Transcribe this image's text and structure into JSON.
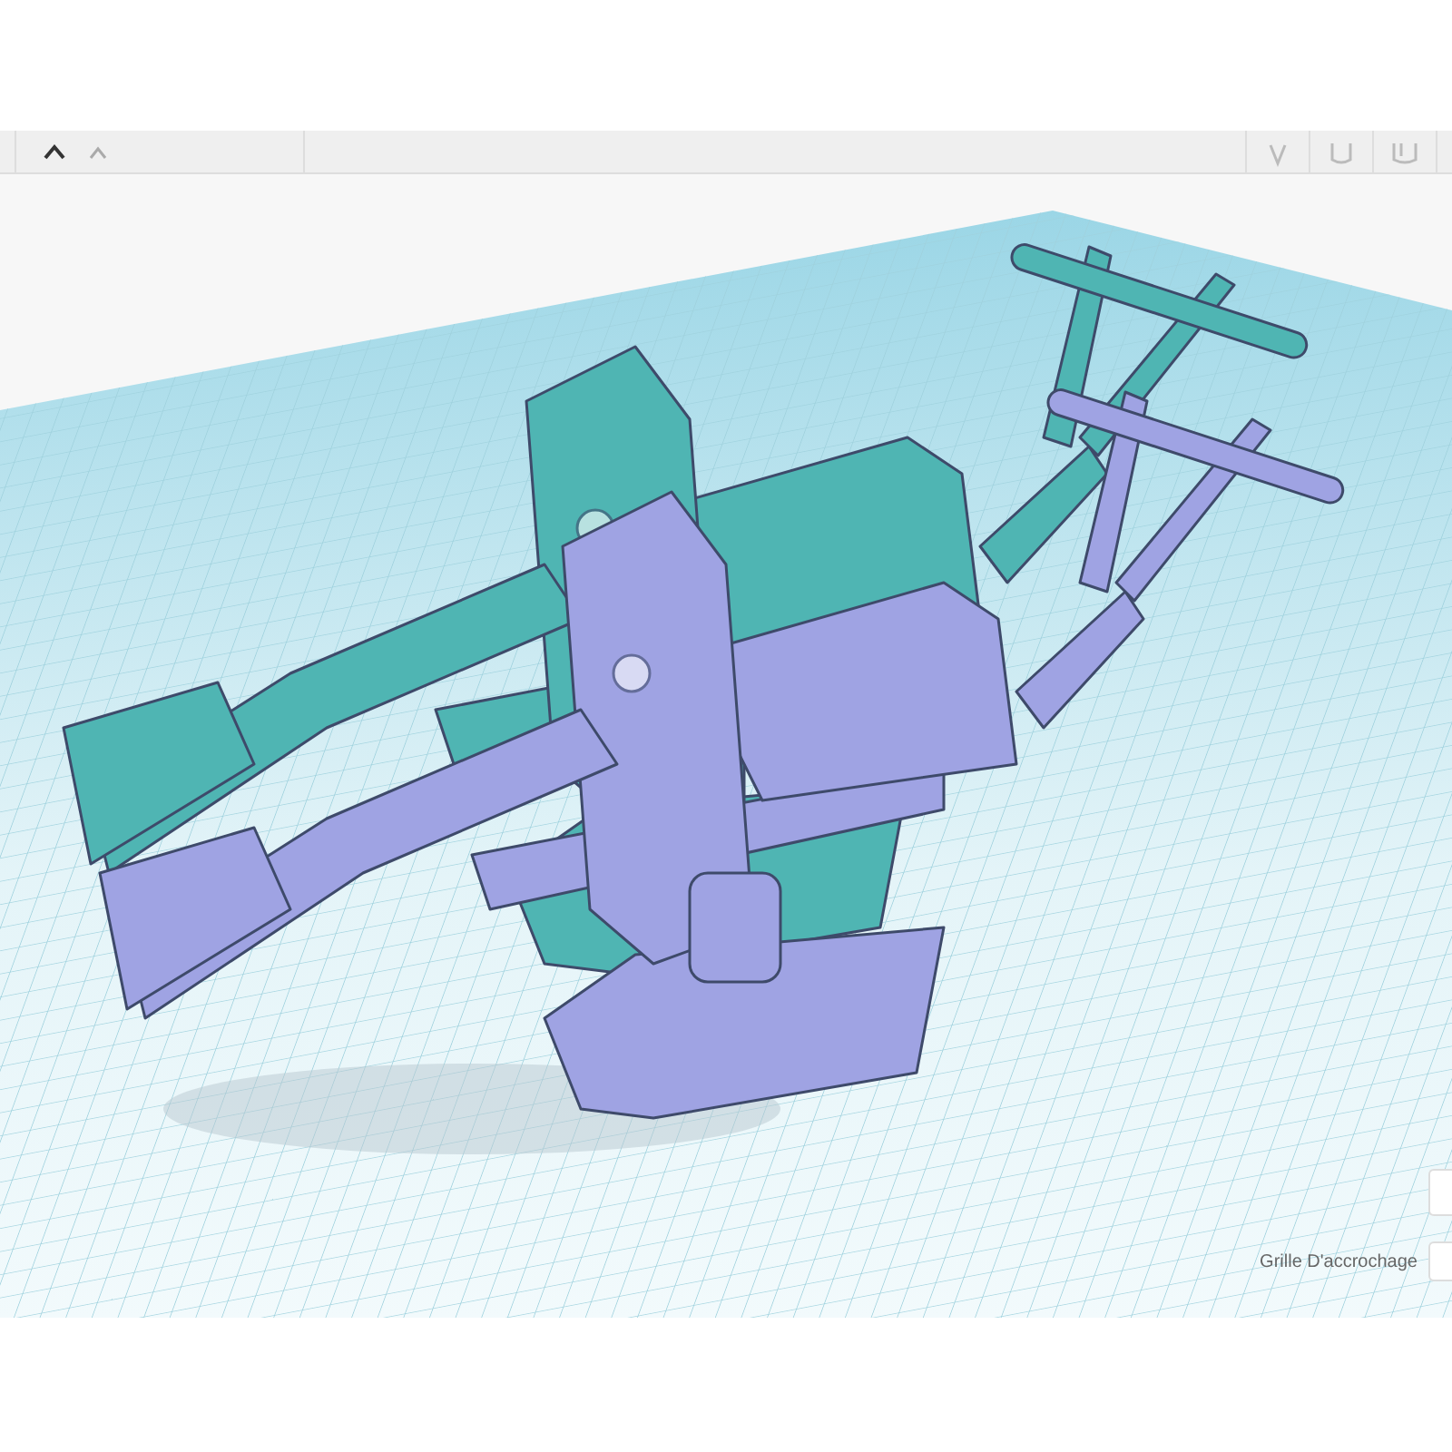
{
  "models": [
    {
      "color": "#4fb5b3"
    },
    {
      "color": "#9fa3e3"
    }
  ],
  "snap_grid": {
    "label": "Grille D'accrochage"
  }
}
